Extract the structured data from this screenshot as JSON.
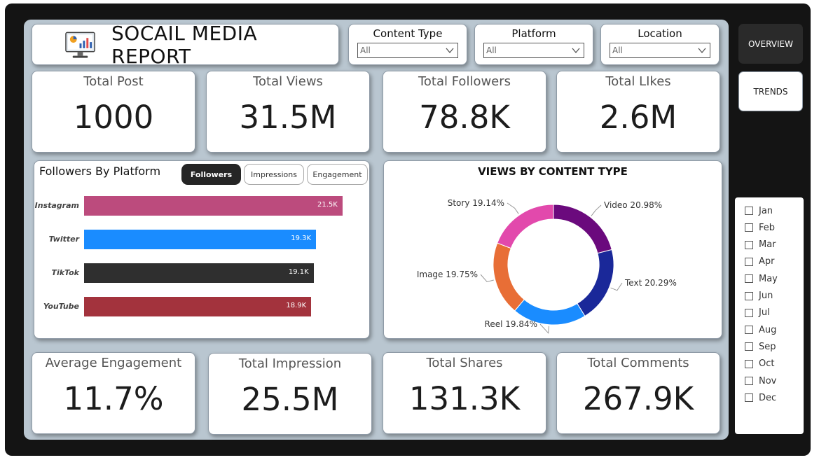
{
  "header": {
    "title": "SOCAIL MEDIA REPORT"
  },
  "filters": [
    {
      "label": "Content Type",
      "value": "All"
    },
    {
      "label": "Platform",
      "value": "All"
    },
    {
      "label": "Location",
      "value": "All"
    }
  ],
  "nav": {
    "overview": "OVERVIEW",
    "trends": "TRENDS"
  },
  "kpis_top": [
    {
      "label": "Total Post",
      "value": "1000"
    },
    {
      "label": "Total Views",
      "value": "31.5M"
    },
    {
      "label": "Total Followers",
      "value": "78.8K"
    },
    {
      "label": "Total LIkes",
      "value": "2.6M"
    }
  ],
  "kpis_bottom": [
    {
      "label": "Average Engagement",
      "value": "11.7%"
    },
    {
      "label": "Total Impression",
      "value": "25.5M"
    },
    {
      "label": "Total Shares",
      "value": "131.3K"
    },
    {
      "label": "Total Comments",
      "value": "267.9K"
    }
  ],
  "months": [
    "Jan",
    "Feb",
    "Mar",
    "Apr",
    "May",
    "Jun",
    "Jul",
    "Aug",
    "Sep",
    "Oct",
    "Nov",
    "Dec"
  ],
  "bar_card": {
    "title": "Followers By Platform",
    "tabs": [
      "Followers",
      "Impressions",
      "Engagement"
    ],
    "active_tab": "Followers"
  },
  "donut_card": {
    "title": "VIEWS BY CONTENT TYPE"
  },
  "chart_data": [
    {
      "type": "bar",
      "orientation": "horizontal",
      "title": "Followers By Platform",
      "categories": [
        "Instagram",
        "Twitter",
        "TikTok",
        "YouTube"
      ],
      "values": [
        21.5,
        19.3,
        19.1,
        18.9
      ],
      "value_labels": [
        "21.5K",
        "19.3K",
        "19.1K",
        "18.9K"
      ],
      "colors": [
        "#bc4b7d",
        "#1a8cff",
        "#2f2f2f",
        "#a3333d"
      ],
      "xlim": [
        0,
        22.5
      ]
    },
    {
      "type": "pie",
      "style": "donut",
      "title": "VIEWS BY CONTENT TYPE",
      "slices": [
        {
          "label": "Video",
          "value": 20.98,
          "text": "Video 20.98%",
          "color": "#6b0a7d"
        },
        {
          "label": "Text",
          "value": 20.29,
          "text": "Text 20.29%",
          "color": "#1a2899"
        },
        {
          "label": "Reel",
          "value": 19.84,
          "text": "Reel 19.84%",
          "color": "#1a8cff"
        },
        {
          "label": "Image",
          "value": 19.75,
          "text": "Image 19.75%",
          "color": "#e86e36"
        },
        {
          "label": "Story",
          "value": 19.14,
          "text": "Story 19.14%",
          "color": "#e249ac"
        }
      ]
    }
  ]
}
